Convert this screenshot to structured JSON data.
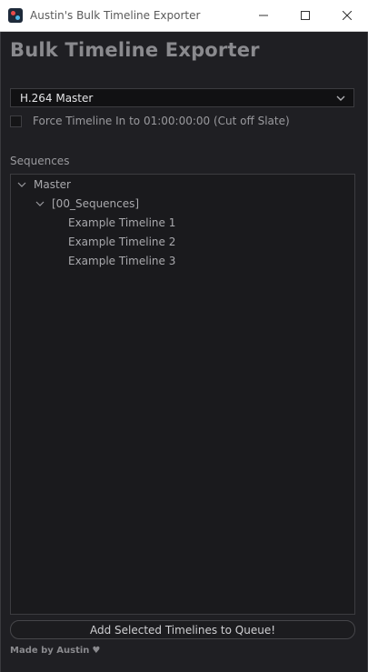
{
  "window": {
    "title": "Austin's Bulk Timeline Exporter",
    "controls": [
      "minimize-icon",
      "maximize-icon",
      "close-icon"
    ]
  },
  "header": {
    "title": "Bulk Timeline Exporter"
  },
  "preset": {
    "selected": "H.264 Master"
  },
  "force_tc": {
    "label": "Force Timeline In to 01:00:00:00 (Cut off Slate)",
    "checked": false
  },
  "sequences": {
    "label": "Sequences",
    "tree": {
      "root": "Master",
      "folder": "[00_Sequences]",
      "items": [
        "Example Timeline 1",
        "Example Timeline 2",
        "Example Timeline 3"
      ]
    }
  },
  "actions": {
    "add_label": "Add Selected Timelines to Queue!"
  },
  "footer": {
    "credit": "Made by Austin",
    "heart": "♥"
  },
  "colors": {
    "background": "#1f1f23",
    "panel": "#1a1a1d",
    "border": "#3c3c40"
  }
}
